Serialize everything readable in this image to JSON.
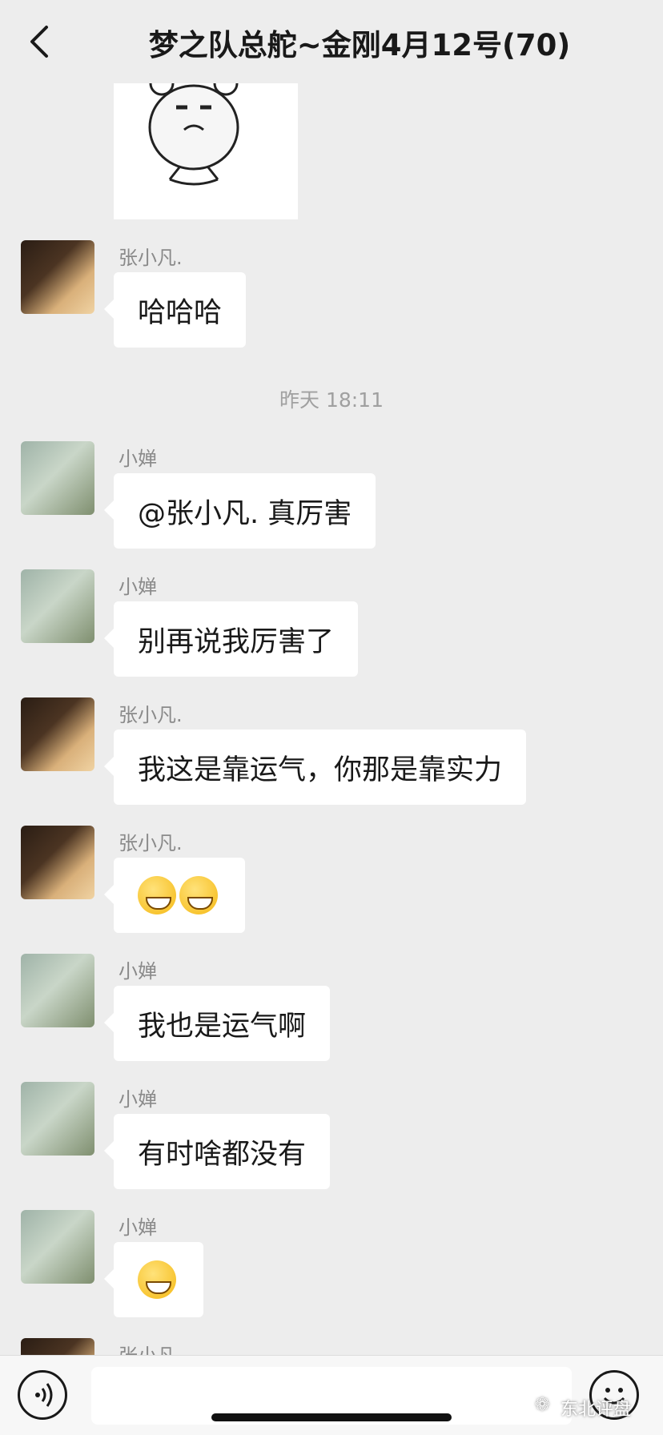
{
  "header": {
    "title": "梦之队总舵~金刚4月12号(70)"
  },
  "chat": {
    "timestamp": "昨天 18:11",
    "messages": [
      {
        "sender": "张小凡.",
        "text": "哈哈哈",
        "avatar": "dog"
      },
      {
        "sender": "小婵",
        "text": "@张小凡. 真厉害",
        "avatar": "girl"
      },
      {
        "sender": "小婵",
        "text": "别再说我厉害了",
        "avatar": "girl"
      },
      {
        "sender": "张小凡.",
        "text": "我这是靠运气，你那是靠实力",
        "avatar": "dog"
      },
      {
        "sender": "张小凡.",
        "text": "",
        "avatar": "dog",
        "emoji": "grin-emoji x2"
      },
      {
        "sender": "小婵",
        "text": "我也是运气啊",
        "avatar": "girl"
      },
      {
        "sender": "小婵",
        "text": "有时啥都没有",
        "avatar": "girl"
      },
      {
        "sender": "小婵",
        "text": "",
        "avatar": "girl",
        "emoji": "tears-of-joy-emoji"
      },
      {
        "sender": "张小凡.",
        "avatar": "dog"
      }
    ]
  },
  "watermark": "东北评盘",
  "icons": [
    "back-chevron-icon",
    "voice-icon",
    "emoji-icon",
    "wechat-logo-icon"
  ]
}
